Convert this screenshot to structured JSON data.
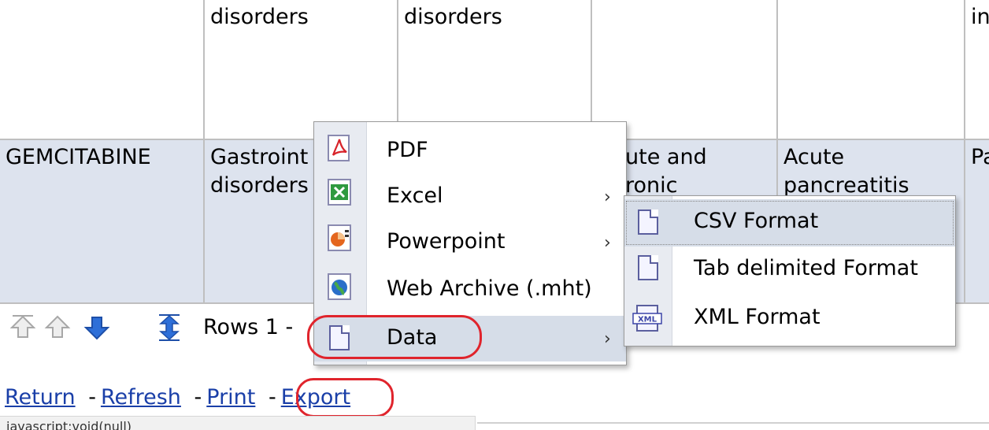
{
  "table": {
    "row1": {
      "col2": "disorders",
      "col3": "disorders",
      "col6": "in"
    },
    "row2": {
      "col1": "GEMCITABINE",
      "col2_line1": "Gastroint",
      "col2_line2": "disorders",
      "col4_line1": "ute and",
      "col4_line2": "ronic",
      "col5_line1": "Acute",
      "col5_line2": "pancreatitis",
      "col6": "Pa"
    }
  },
  "pager": {
    "rows_label": "Rows 1 -",
    "icons": [
      "first-page-icon",
      "previous-page-icon",
      "next-page-icon",
      "all-rows-icon"
    ]
  },
  "links": {
    "return": "Return",
    "refresh": "Refresh",
    "print": "Print",
    "export": "Export",
    "separator": "-"
  },
  "status_bar": {
    "text": "javascript:void(null)"
  },
  "export_menu": {
    "items": [
      {
        "label": "PDF",
        "icon": "pdf-icon",
        "has_submenu": false
      },
      {
        "label": "Excel",
        "icon": "excel-icon",
        "has_submenu": true
      },
      {
        "label": "Powerpoint",
        "icon": "powerpoint-icon",
        "has_submenu": true
      },
      {
        "label": "Web Archive (.mht)",
        "icon": "web-archive-icon",
        "has_submenu": false
      },
      {
        "label": "Data",
        "icon": "data-icon",
        "has_submenu": true,
        "highlighted": true
      }
    ]
  },
  "data_submenu": {
    "items": [
      {
        "label": "CSV Format",
        "icon": "csv-file-icon",
        "highlighted": true
      },
      {
        "label": "Tab delimited Format",
        "icon": "tab-file-icon"
      },
      {
        "label": "XML Format",
        "icon": "xml-file-icon"
      }
    ]
  },
  "colors": {
    "link": "#1a3fa8",
    "row_highlight": "#dde3ee",
    "menu_highlight": "#d6dde8",
    "annotation_ring": "#e0242c"
  }
}
